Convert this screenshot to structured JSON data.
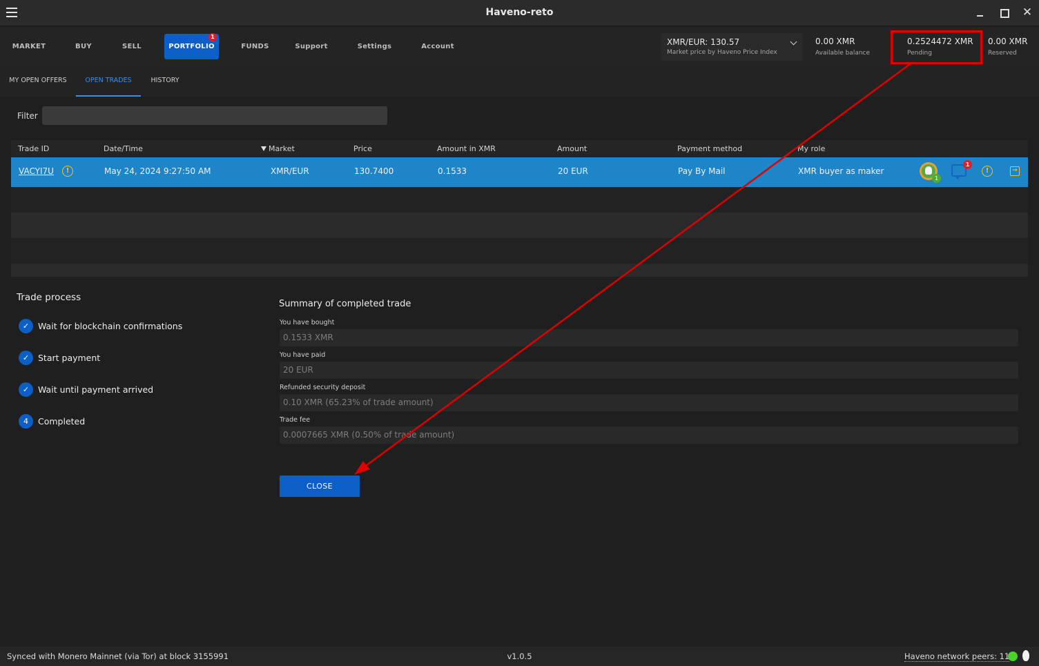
{
  "window": {
    "title": "Haveno-reto"
  },
  "nav": {
    "items": [
      "MARKET",
      "BUY",
      "SELL",
      "PORTFOLIO",
      "FUNDS",
      "Support",
      "Settings",
      "Account"
    ],
    "active": "PORTFOLIO",
    "portfolio_badge": "1"
  },
  "price": {
    "value": "XMR/EUR: 130.57",
    "source": "Market price by Haveno Price Index"
  },
  "balances": {
    "available": {
      "value": "0.00 XMR",
      "label": "Available balance"
    },
    "pending": {
      "value": "0.2524472 XMR",
      "label": "Pending"
    },
    "reserved": {
      "value": "0.00 XMR",
      "label": "Reserved"
    }
  },
  "subtabs": [
    "MY OPEN OFFERS",
    "OPEN TRADES",
    "HISTORY"
  ],
  "active_subtab": "OPEN TRADES",
  "filter": {
    "label": "Filter",
    "value": ""
  },
  "table": {
    "headers": [
      "Trade ID",
      "Date/Time",
      "Market",
      "Price",
      "Amount in XMR",
      "Amount",
      "Payment method",
      "My role"
    ],
    "sorted_by": "Market",
    "rows": [
      {
        "trade_id": "VACYI7U",
        "datetime": "May 24, 2024 9:27:50 AM",
        "market": "XMR/EUR",
        "price": "130.7400",
        "amount_xmr": "0.1533",
        "amount": "20 EUR",
        "payment_method": "Pay By Mail",
        "role": "XMR buyer as maker",
        "peer_badge": "1",
        "chat_badge": "1"
      }
    ]
  },
  "trade_process": {
    "title": "Trade process",
    "steps": [
      {
        "label": "Wait for blockchain confirmations",
        "marker": "✓"
      },
      {
        "label": "Start payment",
        "marker": "✓"
      },
      {
        "label": "Wait until payment arrived",
        "marker": "✓"
      },
      {
        "label": "Completed",
        "marker": "4"
      }
    ]
  },
  "summary": {
    "title": "Summary of completed trade",
    "fields": [
      {
        "label": "You have bought",
        "value": "0.1533 XMR"
      },
      {
        "label": "You have paid",
        "value": "20 EUR"
      },
      {
        "label": "Refunded security deposit",
        "value": "0.10 XMR (65.23% of trade amount)"
      },
      {
        "label": "Trade fee",
        "value": "0.0007665 XMR (0.50% of trade amount)"
      }
    ],
    "close_label": "CLOSE"
  },
  "status": {
    "sync": "Synced with Monero Mainnet (via Tor) at block 3155991",
    "version": "v1.0.5",
    "peers": "Haveno network peers: 11"
  },
  "colors": {
    "accent": "#0b5fc7",
    "selected_row": "#1d85c8",
    "annotation": "#e00000",
    "warning": "#f2c12e"
  }
}
